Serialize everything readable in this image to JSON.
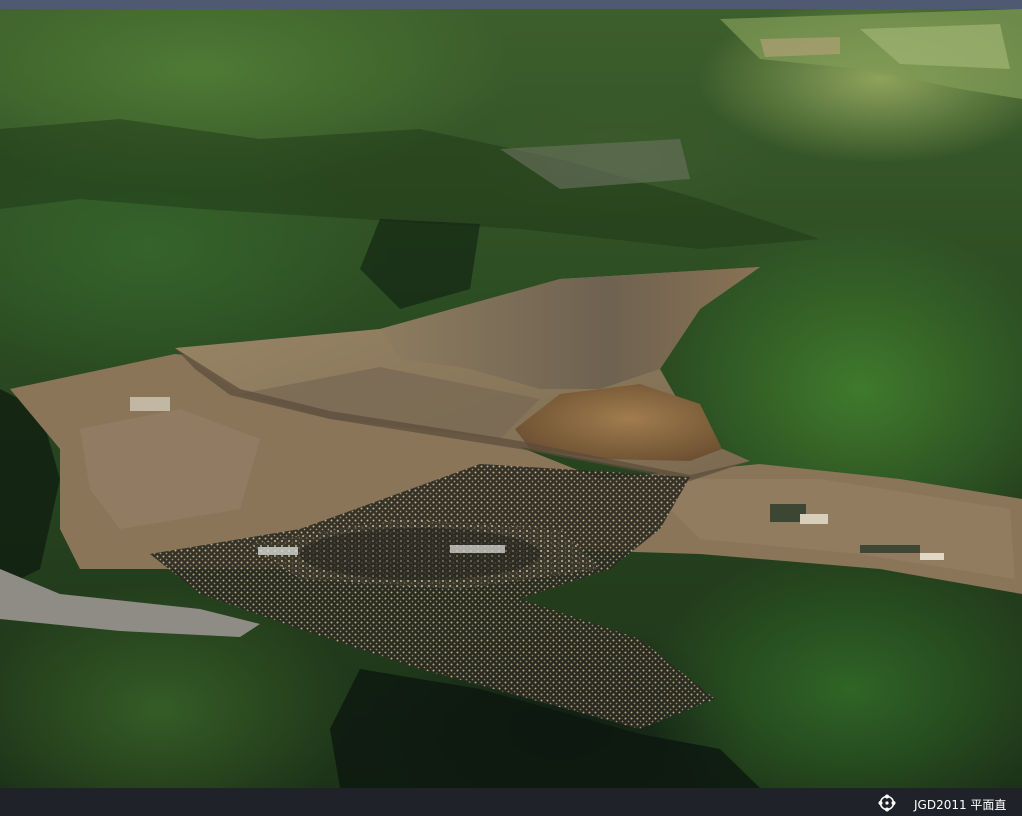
{
  "viewer": {
    "icons": {
      "navigation": "navigation-icon"
    }
  },
  "status_bar": {
    "crs_label": "JGD2011 平面直"
  }
}
